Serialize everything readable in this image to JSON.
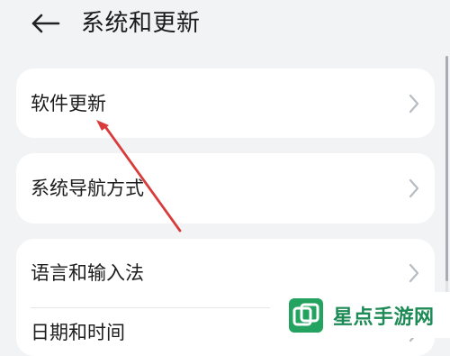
{
  "header": {
    "back_icon": "arrow-left-icon",
    "title": "系统和更新"
  },
  "settings": {
    "items": [
      {
        "label": "软件更新",
        "chevron_icon": "chevron-right-icon"
      },
      {
        "label": "系统导航方式",
        "chevron_icon": "chevron-right-icon"
      },
      {
        "label": "语言和输入法",
        "chevron_icon": "chevron-right-icon"
      },
      {
        "label": "日期和时间",
        "chevron_icon": "chevron-right-icon"
      }
    ]
  },
  "annotation": {
    "icon": "red-arrow-icon",
    "color": "#d93a3a"
  },
  "watermark": {
    "logo_icon": "xingdian-logo-icon",
    "text": "星点手游网",
    "color": "#1d8b56"
  },
  "colors": {
    "background": "#f1f3f5",
    "card": "#ffffff",
    "chevron": "#b7bbc2"
  }
}
